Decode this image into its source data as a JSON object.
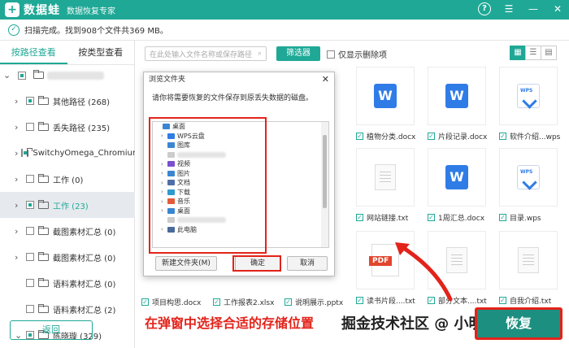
{
  "app": {
    "title": "数据蛙",
    "subtitle": "数据恢复专家",
    "logo": "+",
    "controls": {
      "help": "?",
      "menu": "☰",
      "minimize": "—",
      "close": "✕"
    }
  },
  "status": {
    "text": "扫描完成。找到908个文件共369 MB。"
  },
  "tabs": [
    "按路径查看",
    "按类型查看"
  ],
  "tree": [
    {
      "label": "其他路径 (268)",
      "chev": "›",
      "partial": true
    },
    {
      "label": "丢失路径 (235)",
      "chev": "›",
      "partial": false
    },
    {
      "label": "SwitchyOmega_Chromium",
      "chev": "›",
      "partial": true
    },
    {
      "label": "工作 (0)",
      "chev": "›",
      "partial": false
    },
    {
      "label": "工作 (23)",
      "chev": "›",
      "partial": true,
      "selected": true
    },
    {
      "label": "截图素材汇总 (0)",
      "chev": "›",
      "partial": false
    },
    {
      "label": "截图素材汇总 (0)",
      "chev": "›",
      "partial": false
    },
    {
      "label": "语料素材汇总 (0)",
      "chev": "",
      "partial": false
    },
    {
      "label": "语料素材汇总 (2)",
      "chev": "",
      "partial": false
    },
    {
      "label": "陈晓璇 (329)",
      "chev": "⌄",
      "partial": true
    }
  ],
  "back_button": "返回",
  "search": {
    "placeholder": "在此处输入文件名称或保存路径"
  },
  "filter_button": "筛选器",
  "only_deleted": "仅显示删除项",
  "view": {
    "grid": "▦",
    "list": "☰",
    "detail": "▤"
  },
  "files_row1": [
    {
      "name": "植物分类.docx"
    },
    {
      "name": "片段记录.docx"
    },
    {
      "name": "软件介绍...wps"
    }
  ],
  "files_row2": [
    {
      "name": "网站链接.txt"
    },
    {
      "name": "1周汇总.docx"
    },
    {
      "name": "目录.wps"
    }
  ],
  "files_row3": [
    {
      "name": "读书片段....txt"
    },
    {
      "name": "部分文本....txt"
    },
    {
      "name": "自我介绍.txt"
    }
  ],
  "files_bottom": [
    {
      "name": "项目构思.docx"
    },
    {
      "name": "工作报表2.xlsx"
    },
    {
      "name": "说明展示.pptx"
    }
  ],
  "file_icons": {
    "word": "W",
    "wps": "WPS",
    "pdf": "PDF"
  },
  "dialog": {
    "title": "浏览文件夹",
    "close": "✕",
    "prompt": "请你将需要恢复的文件保存到原丢失数据的磁盘。",
    "folders": [
      {
        "label": "桌面",
        "indent": 0,
        "chev": "",
        "color": "#3a86d1"
      },
      {
        "label": "WPS云盘",
        "indent": 1,
        "chev": "›",
        "color": "#2f7ce6"
      },
      {
        "label": "图库",
        "indent": 1,
        "chev": "",
        "color": "#3a86d1"
      },
      {
        "label": "",
        "indent": 1,
        "chev": "",
        "color": "#cccccc"
      },
      {
        "label": "视频",
        "indent": 1,
        "chev": "›",
        "color": "#7a4fd0"
      },
      {
        "label": "图片",
        "indent": 1,
        "chev": "›",
        "color": "#3a86d1"
      },
      {
        "label": "文档",
        "indent": 1,
        "chev": "›",
        "color": "#4f6fa8"
      },
      {
        "label": "下载",
        "indent": 1,
        "chev": "›",
        "color": "#2f9ad0"
      },
      {
        "label": "音乐",
        "indent": 1,
        "chev": "›",
        "color": "#e35b3a"
      },
      {
        "label": "桌面",
        "indent": 1,
        "chev": "›",
        "color": "#3a86d1"
      },
      {
        "label": "",
        "indent": 1,
        "chev": "",
        "color": "#cccccc"
      },
      {
        "label": "此电脑",
        "indent": 1,
        "chev": "›",
        "color": "#4a6a9a"
      }
    ],
    "new_folder": "新建文件夹(M)",
    "ok": "确定",
    "cancel": "取消"
  },
  "annotation": "在弹窗中选择合适的存储位置",
  "watermark": "掘金技术社区 @ 小明助手",
  "recover_button": "恢复",
  "colors": {
    "accent": "#1fa896",
    "highlight": "#e2231a"
  }
}
